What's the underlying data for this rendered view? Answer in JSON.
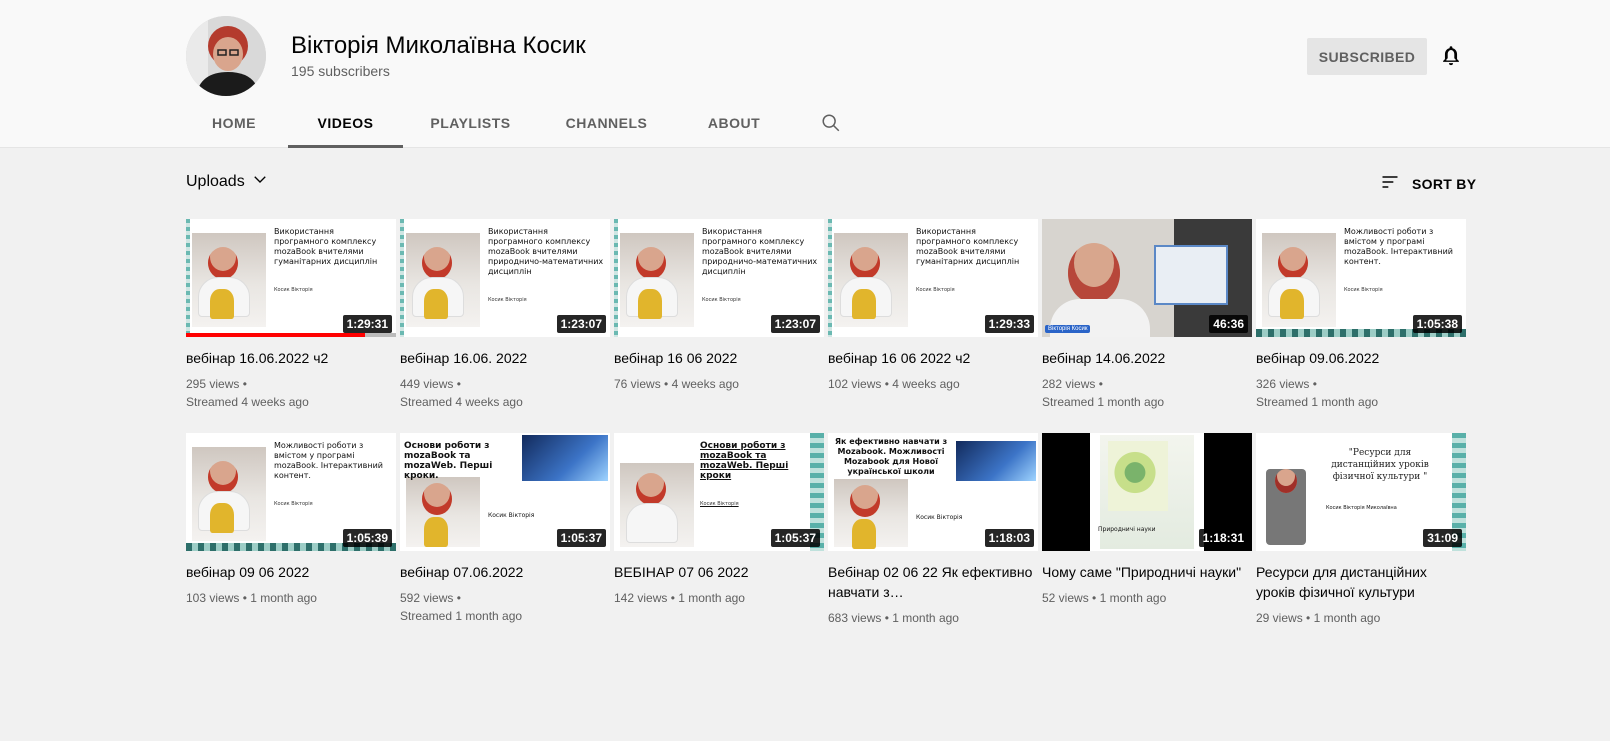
{
  "channel": {
    "name": "Вікторія Миколаївна Косик",
    "subscribers": "195 subscribers",
    "subscribe_label": "SUBSCRIBED"
  },
  "tabs": [
    {
      "label": "HOME",
      "active": false
    },
    {
      "label": "VIDEOS",
      "active": true
    },
    {
      "label": "PLAYLISTS",
      "active": false
    },
    {
      "label": "CHANNELS",
      "active": false
    },
    {
      "label": "ABOUT",
      "active": false
    }
  ],
  "toolbar": {
    "uploads_label": "Uploads",
    "sort_label": "SORT BY"
  },
  "icons": {
    "bell": "bell-icon",
    "search": "search-icon",
    "chevron": "chevron-down-icon",
    "sort": "sort-icon"
  },
  "videos": [
    {
      "title": "вебінар 16.06.2022 ч2",
      "views": "295 views",
      "age": "Streamed 4 weeks ago",
      "duration": "1:29:31",
      "watched": 0.85
    },
    {
      "title": "вебінар 16.06. 2022",
      "views": "449 views",
      "age": "Streamed 4 weeks ago",
      "duration": "1:23:07",
      "watched": 0.0
    },
    {
      "title": "вебінар 16 06 2022",
      "views": "76 views",
      "age": "4 weeks ago",
      "duration": "1:23:07",
      "watched": 0.0
    },
    {
      "title": "вебінар 16 06 2022 ч2",
      "views": "102 views",
      "age": "4 weeks ago",
      "duration": "1:29:33",
      "watched": 0.0
    },
    {
      "title": "вебінар 14.06.2022",
      "views": "282 views",
      "age": "Streamed 1 month ago",
      "duration": "46:36",
      "watched": 0.0
    },
    {
      "title": "вебінар 09.06.2022",
      "views": "326 views",
      "age": "Streamed 1 month ago",
      "duration": "1:05:38",
      "watched": 0.0
    },
    {
      "title": "вебінар 09 06 2022",
      "views": "103 views",
      "age": "1 month ago",
      "duration": "1:05:39",
      "watched": 0.0
    },
    {
      "title": "вебінар 07.06.2022",
      "views": "592 views",
      "age": "Streamed 1 month ago",
      "duration": "1:05:37",
      "watched": 0.0
    },
    {
      "title": "ВЕБІНАР 07 06 2022",
      "views": "142 views",
      "age": "1 month ago",
      "duration": "1:05:37",
      "watched": 0.0
    },
    {
      "title": "Вебінар 02 06 22 Як ефективно навчати з…",
      "views": "683 views",
      "age": "1 month ago",
      "duration": "1:18:03",
      "watched": 0.0
    },
    {
      "title": "Чому саме \"Природничі науки\"",
      "views": "52 views",
      "age": "1 month ago",
      "duration": "1:18:31",
      "watched": 0.0
    },
    {
      "title": "Ресурси для дистанційних уроків фізичної культури",
      "views": "29 views",
      "age": "1 month ago",
      "duration": "31:09",
      "watched": 0.0
    }
  ],
  "thumbnails": {
    "t1": {
      "heading": "Використання програмного комплексу mozaBook вчителями гуманітарних дисциплін",
      "author": "Косик Вікторія"
    },
    "t2": {
      "heading": "Використання програмного комплексу mozaBook вчителями природничо-математичних дисциплін",
      "author": "Косик Вікторія"
    },
    "t6": {
      "heading": "Можливості роботи з вмістом у програмі mozaBook. Інтерактивний контент.",
      "author": "Косик Вікторія"
    },
    "t8": {
      "heading": "Основи роботи з mozaBook та mozaWeb. Перші кроки.",
      "author": "Косик Вікторія"
    },
    "t9": {
      "heading": "Основи роботи з mozaBook та mozaWeb. Перші кроки",
      "author": "Косик Вікторія"
    },
    "t10": {
      "heading": "Як ефективно навчати з Mozabook. Можливості Mozabook для Нової української школи",
      "author": "Косик Вікторія"
    },
    "t11": {
      "heading": "Природничі науки"
    },
    "t12": {
      "heading": "\"Ресурси для дистанційних уроків фізичної культури \"",
      "author": "Косик Вікторія Миколаївна"
    },
    "t5_tag": "Вікторія Косик"
  }
}
